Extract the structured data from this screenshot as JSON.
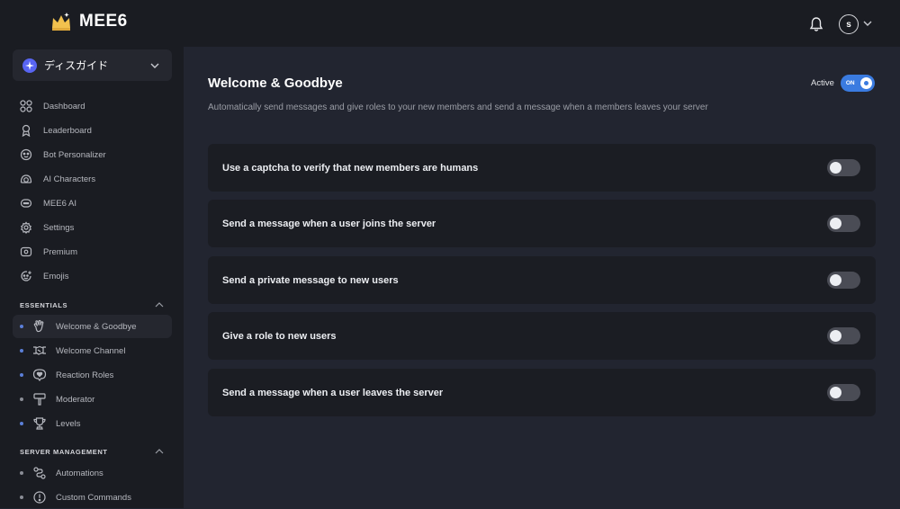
{
  "brand": {
    "name": "MEE6"
  },
  "header": {
    "avatar_initial": "s"
  },
  "server": {
    "name": "ディスガイド"
  },
  "nav": [
    {
      "label": "Dashboard",
      "icon": "grid-icon"
    },
    {
      "label": "Leaderboard",
      "icon": "medal-icon"
    },
    {
      "label": "Bot Personalizer",
      "icon": "bot-face-icon"
    },
    {
      "label": "AI Characters",
      "icon": "ai-characters-icon"
    },
    {
      "label": "MEE6 AI",
      "icon": "chat-bubble-icon"
    },
    {
      "label": "Settings",
      "icon": "gear-icon"
    },
    {
      "label": "Premium",
      "icon": "premium-icon"
    },
    {
      "label": "Emojis",
      "icon": "emoji-icon"
    }
  ],
  "sections": [
    {
      "title": "ESSENTIALS",
      "items": [
        {
          "label": "Welcome & Goodbye",
          "icon": "waving-hand-icon",
          "active": true
        },
        {
          "label": "Welcome Channel",
          "icon": "handshake-icon",
          "active": false
        },
        {
          "label": "Reaction Roles",
          "icon": "reaction-heart-icon",
          "active": false
        },
        {
          "label": "Moderator",
          "icon": "hammer-icon",
          "active": false
        },
        {
          "label": "Levels",
          "icon": "trophy-icon",
          "active": false
        }
      ]
    },
    {
      "title": "SERVER MANAGEMENT",
      "items": [
        {
          "label": "Automations",
          "icon": "automation-icon",
          "active": false
        },
        {
          "label": "Custom Commands",
          "icon": "alert-circle-icon",
          "active": false
        }
      ]
    }
  ],
  "page": {
    "title": "Welcome & Goodbye",
    "description": "Automatically send messages and give roles to your new members and send a message when a members leaves your server",
    "active_label": "Active",
    "active_toggle_text": "ON",
    "active": true
  },
  "options": [
    {
      "label": "Use a captcha to verify that new members are humans",
      "enabled": false
    },
    {
      "label": "Send a message when a user joins the server",
      "enabled": false
    },
    {
      "label": "Send a private message to new users",
      "enabled": false
    },
    {
      "label": "Give a role to new users",
      "enabled": false
    },
    {
      "label": "Send a message when a user leaves the server",
      "enabled": false
    }
  ],
  "colors": {
    "accent": "#3a7be0",
    "background": "#222530",
    "sidebar": "#1a1c22",
    "card": "#1b1d23"
  }
}
